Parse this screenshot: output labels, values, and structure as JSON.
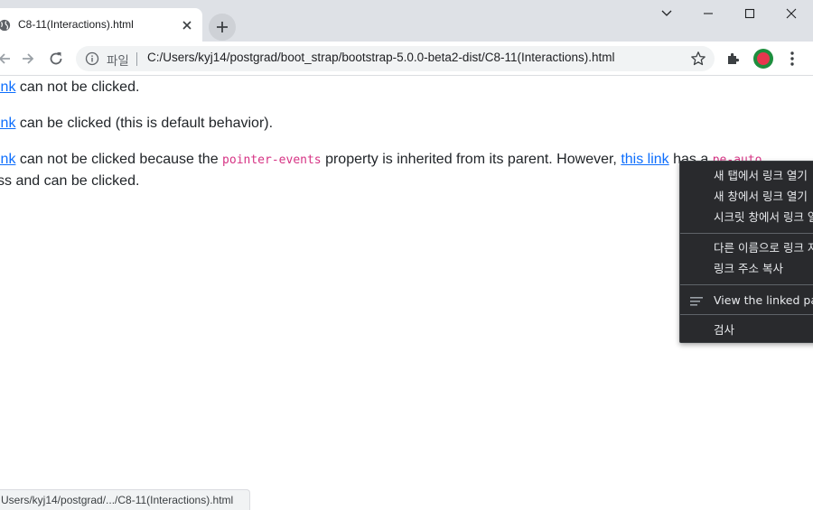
{
  "browser": {
    "tab": {
      "title": "C8-11(Interactions).html"
    },
    "omnibox": {
      "scheme_label": "파일",
      "url": "C:/Users/kyj14/postgrad/boot_strap/bootstrap-5.0.0-beta2-dist/C8-11(Interactions).html"
    },
    "status_url": "Users/kyj14/postgrad/.../C8-11(Interactions).html"
  },
  "content": {
    "p1": {
      "link": "s link",
      "text": " can not be clicked."
    },
    "p2": {
      "link": "s link",
      "text": " can be clicked (this is default behavior)."
    },
    "p3": {
      "link": "s link",
      "text_a": " can not be clicked because the ",
      "code": "pointer-events",
      "text_b": " property is inherited from its parent. However, ",
      "link2": "this link",
      "text_c": " has a ",
      "code2": "pe-auto"
    },
    "p3_line2": "ss and can be clicked."
  },
  "context_menu": {
    "items": [
      "새 탭에서 링크 열기",
      "새 창에서 링크 열기",
      "시크릿 창에서 링크 열기",
      "다른 이름으로 링크 저장...",
      "링크 주소 복사",
      "View the linked page",
      "검사"
    ]
  },
  "colors": {
    "tabstrip_bg": "#dee1e6",
    "link": "#0d6efd",
    "code": "#d63384",
    "menu_bg": "#292a2d",
    "profile_ring": "#1e8e3e",
    "profile_fill": "#e8364e"
  },
  "icons": {
    "favicon": "globe-icon",
    "tab_close": "close-icon",
    "new_tab": "plus-icon",
    "back": "back-arrow-icon",
    "forward": "forward-arrow-icon",
    "reload": "reload-icon",
    "info": "info-icon",
    "bookmark": "star-icon",
    "extensions": "puzzle-icon",
    "menu": "kebab-menu-icon"
  }
}
